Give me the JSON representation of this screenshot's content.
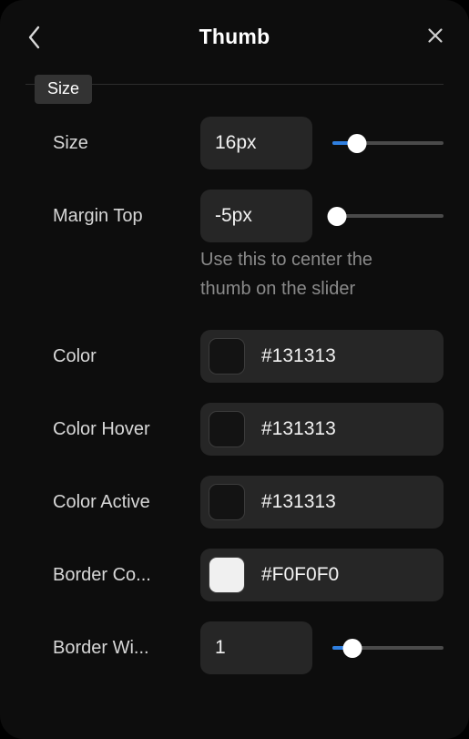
{
  "panel": {
    "title": "Thumb",
    "background_color": "#0d0d0d",
    "back_icon": "chevron-left-icon",
    "close_icon": "close-x-icon"
  },
  "section": {
    "tab_label": "Size"
  },
  "accent_color": "#2f7fe0",
  "rows": {
    "size": {
      "label": "Size",
      "value": "16px",
      "placeholder": "Size",
      "slider": {
        "fill_percent": 22,
        "thumb_percent": 22
      }
    },
    "margin_top": {
      "label": "Margin Top",
      "value": "-5px",
      "placeholder": "Margin Top",
      "slider": {
        "fill_percent": 0,
        "thumb_percent": 4
      },
      "helper": "Use this to center the thumb on the slider"
    },
    "color": {
      "label": "Color",
      "value": "#131313",
      "swatch_color": "#131313",
      "placeholder": "#131313"
    },
    "color_hover": {
      "label": "Color Hover",
      "value": "#131313",
      "swatch_color": "#131313",
      "placeholder": "#131313"
    },
    "color_active": {
      "label": "Color Active",
      "value": "#131313",
      "swatch_color": "#131313",
      "placeholder": "#131313"
    },
    "border_color": {
      "label": "Border Co...",
      "value": "#F0F0F0",
      "swatch_color": "#F0F0F0",
      "placeholder": "#F0F0F0"
    },
    "border_width": {
      "label": "Border Wi...",
      "value": "1",
      "placeholder": "Border Width",
      "slider": {
        "fill_percent": 18,
        "thumb_percent": 18
      }
    }
  }
}
